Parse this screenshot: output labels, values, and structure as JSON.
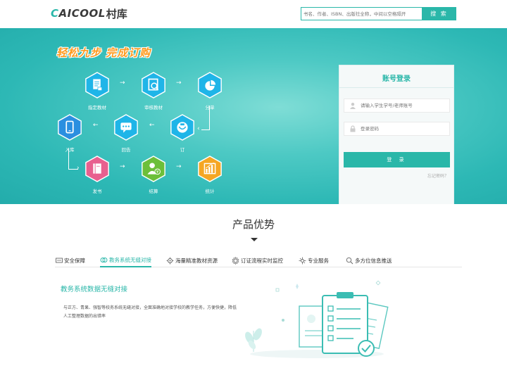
{
  "header": {
    "logo_en": "CAICOOL",
    "logo_cn": "村库",
    "search_placeholder": "书名、作者、ISBN、出版社全称，中间以空格隔开",
    "search_button": "搜 索"
  },
  "banner": {
    "slogan": "轻松九步 完成订购",
    "steps": [
      {
        "label": "指定教材",
        "icon": "book-list-icon",
        "color": "#1fb5e8"
      },
      {
        "label": "审核教材",
        "icon": "review-icon",
        "color": "#1fb5e8"
      },
      {
        "label": "分单",
        "icon": "pie-icon",
        "color": "#1fb5e8"
      },
      {
        "label": "订",
        "icon": "order-icon",
        "color": "#1fb5e8"
      },
      {
        "label": "回告",
        "icon": "message-icon",
        "color": "#1fb5e8"
      },
      {
        "label": "入库",
        "icon": "phone-icon",
        "color": "#2b8fe0"
      },
      {
        "label": "发书",
        "icon": "shipbook-icon",
        "color": "#e8608f"
      },
      {
        "label": "结算",
        "icon": "settle-icon",
        "color": "#6cbf3a"
      },
      {
        "label": "统计",
        "icon": "stats-icon",
        "color": "#f5a623"
      }
    ]
  },
  "login": {
    "title": "账号登录",
    "username_placeholder": "请输入学生学号/老师账号",
    "password_placeholder": "登录密码",
    "login_button": "登 录",
    "forgot": "忘记密码？"
  },
  "advantages": {
    "title": "产品优势",
    "tabs": [
      {
        "label": "安全保障",
        "icon": "shield-icon"
      },
      {
        "label": "教务系统无缝对接",
        "icon": "link-icon"
      },
      {
        "label": "海量精准教材资源",
        "icon": "resource-icon"
      },
      {
        "label": "订证流程实时监控",
        "icon": "monitor-icon"
      },
      {
        "label": "专业服务",
        "icon": "service-icon"
      },
      {
        "label": "多方位信息推送",
        "icon": "push-icon"
      }
    ],
    "active_tab": 1,
    "content_title": "教务系统数据无缝对接",
    "content_desc": "与正方、青果、强智等校务系统无缝对接，全面准确地对接学校的教学任务，方便快捷，降低人工整理数据的出错率"
  },
  "colors": {
    "accent": "#2ab7a9"
  }
}
